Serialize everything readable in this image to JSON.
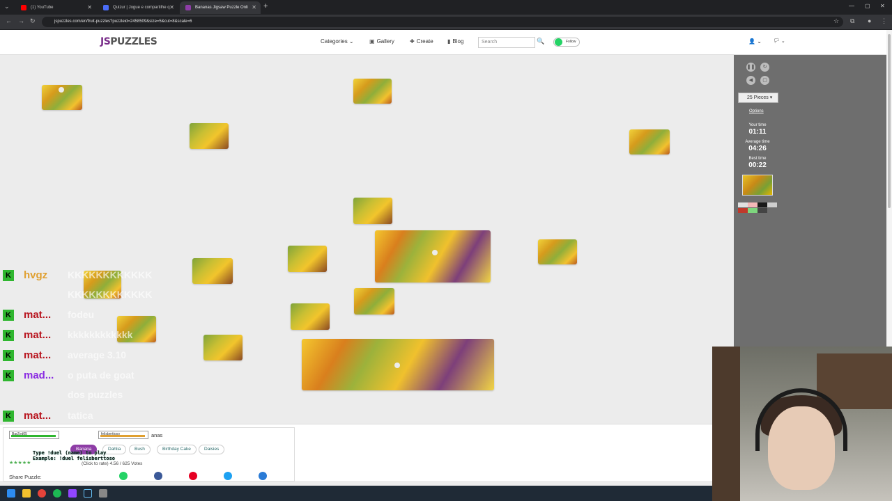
{
  "browser": {
    "tabs": [
      {
        "title": "(1) YouTube",
        "favicon_color": "#ff0000"
      },
      {
        "title": "Quizur | Jogue e compartilhe q",
        "favicon_color": "#4a6cf7"
      },
      {
        "title": "Bananas Jigsaw Puzzle Onli",
        "favicon_color": "#8e3da6"
      }
    ],
    "url": "jspuzzles.com/en/fruit-puzzles?puzzleid=2458509&size=5&cut=8&scale=6"
  },
  "site": {
    "logo_a": "JS",
    "logo_b": "PUZZLES",
    "nav": {
      "categories": "Categories",
      "gallery": "Gallery",
      "create": "Create",
      "blog": "Blog"
    },
    "search_placeholder": "Search",
    "follow_label": "Follow"
  },
  "side_panel": {
    "pieces_label": "25 Pieces",
    "options_label": "Options",
    "your_time_label": "Your time",
    "your_time": "01:11",
    "avg_time_label": "Average time",
    "avg_time": "04:26",
    "best_time_label": "Best time",
    "best_time": "00:22",
    "swatches": [
      "#e0e0e0",
      "#f4b8b8",
      "#1a1a1a",
      "#cfcfcf",
      "#c0392b",
      "#7ed67e",
      "#444444"
    ]
  },
  "chat": [
    {
      "name": "hvgz",
      "color": "#e0a030",
      "message": "KKKKKKKKKKKK"
    },
    {
      "name": "",
      "color": "#e0a030",
      "message": "KKKKKKKKKKKK"
    },
    {
      "name": "mat...",
      "color": "#b8141e",
      "message": "fodeu"
    },
    {
      "name": "mat...",
      "color": "#b8141e",
      "message": "kkkkkkkkkkkk"
    },
    {
      "name": "mat...",
      "color": "#b8141e",
      "message": "average 3.10"
    },
    {
      "name": "mad...",
      "color": "#8a2be2",
      "message": "o puta de goat"
    },
    {
      "name": "",
      "color": "#8a2be2",
      "message": "dos puzzles"
    },
    {
      "name": "mat...",
      "color": "#b8141e",
      "message": "tatica"
    }
  ],
  "bottom": {
    "title_fragment": "anas",
    "tags": [
      "Banana",
      "Dahlia",
      "Bush",
      "Birthday Cake",
      "Daisies"
    ],
    "active_tag": "Banana",
    "rate_text": "(Click to rate)  4.56 / 625 Votes",
    "share_label": "Share Puzzle:",
    "overlay_line1": "Type !duel (name) to play",
    "overlay_line2": "Example: !duel felisberttoso",
    "hp_left": "BarZed05",
    "hp_right": "felisberttoso",
    "share_colors": [
      "#25d366",
      "#3b5998",
      "#e60023",
      "#1da1f2",
      "#2a7bd6"
    ]
  }
}
